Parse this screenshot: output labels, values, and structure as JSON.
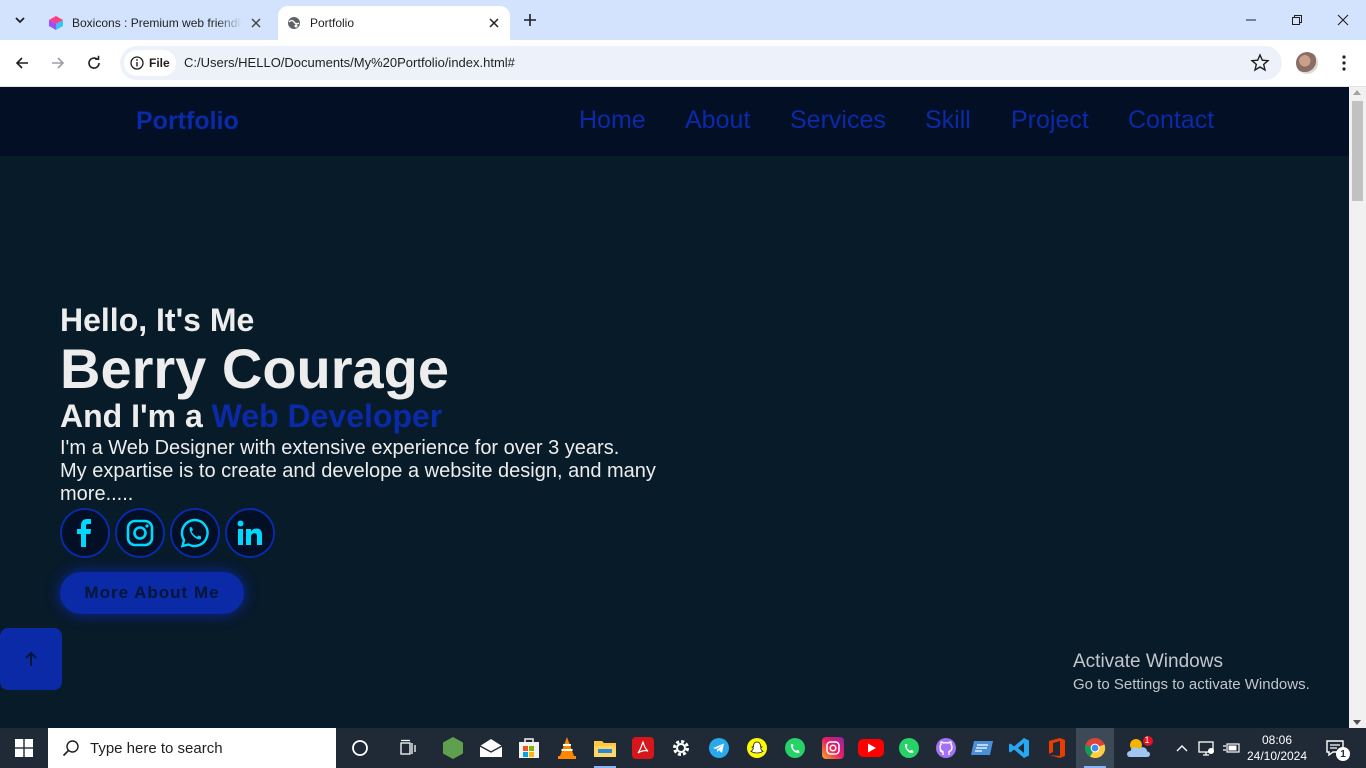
{
  "browser": {
    "tabs": [
      {
        "title": "Boxicons : Premium web friendly icons",
        "favicon": "boxicons-logo-icon",
        "active": false
      },
      {
        "title": "Portfolio",
        "favicon": "globe-icon",
        "active": true
      }
    ],
    "address_scheme_chip": "File",
    "url": "C:/Users/HELLO/Documents/My%20Portfolio/index.html#"
  },
  "site": {
    "logo": "Portfolio",
    "nav": [
      "Home",
      "About",
      "Services",
      "Skill",
      "Project",
      "Contact"
    ],
    "accent_color": "#0a2aa8",
    "bg_color": "#081b29",
    "header_color": "#020f25"
  },
  "home": {
    "greeting": "Hello, It's Me",
    "name": "Berry Courage",
    "role_prefix": "And I'm a ",
    "role": "Web Developer",
    "paragraph_line1": "I'm a Web Designer with extensive experience for over 3 years.",
    "paragraph_line2": "My expartise is to create and develope a website design, and many more.....",
    "socials": [
      "facebook-icon",
      "instagram-icon",
      "whatsapp-icon",
      "linkedin-icon"
    ],
    "button": "More About Me"
  },
  "watermark": {
    "title": "Activate Windows",
    "subtitle": "Go to Settings to activate Windows."
  },
  "taskbar": {
    "search_placeholder": "Type here to search",
    "time": "08:06",
    "date": "24/10/2024",
    "weather_badge": "1",
    "notification_count": "1"
  }
}
